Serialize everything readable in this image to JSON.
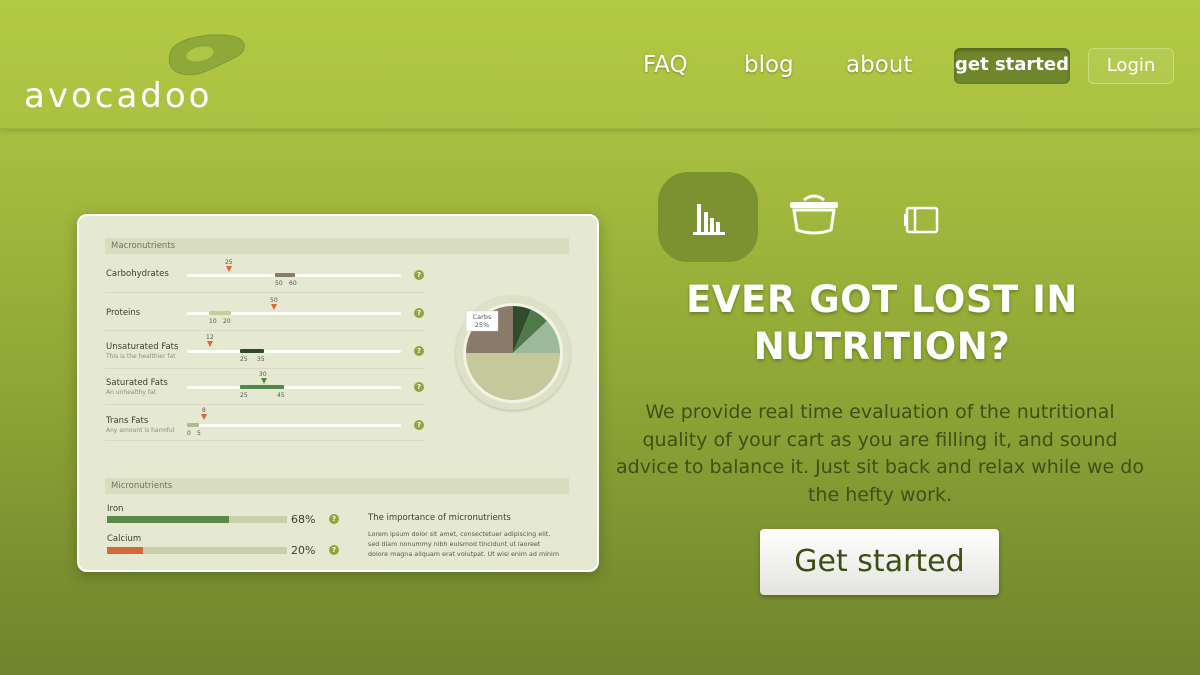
{
  "brand": {
    "name": "avocadoo"
  },
  "nav": {
    "faq": "FAQ",
    "blog": "blog",
    "about": "about",
    "get_started": "get started",
    "login": "Login"
  },
  "colors": {
    "brand_green": "#a8bf40",
    "dark_green": "#6f872c",
    "text_dark": "#3f4f16"
  },
  "panel": {
    "macro_title": "Macronutrients",
    "macros": [
      {
        "name": "Carbohydrates",
        "sub": "",
        "value": "25",
        "range_low": "50",
        "range_high": "60"
      },
      {
        "name": "Proteins",
        "sub": "",
        "value": "50",
        "range_low": "10",
        "range_high": "20"
      },
      {
        "name": "Unsaturated Fats",
        "sub": "This is the healthier fat",
        "value": "12",
        "range_low": "25",
        "range_high": "35"
      },
      {
        "name": "Saturated Fats",
        "sub": "An unhealthy fat",
        "value": "30",
        "range_low": "25",
        "range_high": "45"
      },
      {
        "name": "Trans Fats",
        "sub": "Any amount is harmful",
        "value": "8",
        "range_low": "0",
        "range_high": "5"
      }
    ],
    "help_icon": "?",
    "pie_label": "Carbs",
    "pie_pct": "25%",
    "micro_title": "Micronutrients",
    "micros": [
      {
        "name": "Iron",
        "pct": "68%",
        "fraction": 0.68,
        "color": "#5a8a4a"
      },
      {
        "name": "Calcium",
        "pct": "20%",
        "fraction": 0.2,
        "color": "#d66a36"
      }
    ],
    "importance_title": "The importance of micronutrients",
    "importance_body": "Lorem ipsum dolor sit amet, consectetuer adipiscing elit, sed diam nonummy nibh euismod tincidunt ut laoreet dolore magna aliquam erat volutpat. Ut wisi enim ad minim"
  },
  "icons": [
    "bar-chart-icon",
    "pot-icon",
    "notebook-icon"
  ],
  "hero": {
    "headline": "EVER GOT LOST IN NUTRITION?",
    "description": "We provide real time evaluation of the nutritional quality of your cart as you are filling it, and sound advice to balance it. Just sit back and relax while we do the hefty work.",
    "cta": "Get started"
  }
}
